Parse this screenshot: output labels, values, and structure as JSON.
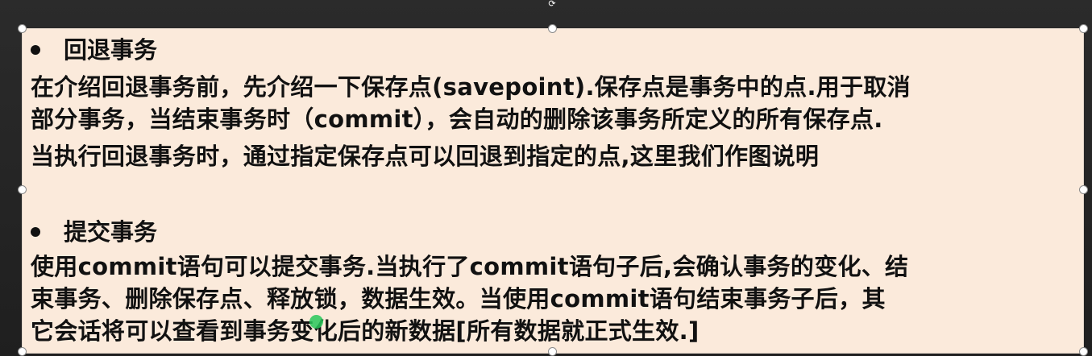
{
  "section1": {
    "heading": "回退事务",
    "lines": [
      "在介绍回退事务前，先介绍一下保存点(savepoint).保存点是事务中的点.用于取消",
      "部分事务，当结束事务时（commit），会自动的删除该事务所定义的所有保存点.",
      "当执行回退事务时，通过指定保存点可以回退到指定的点,这里我们作图说明"
    ]
  },
  "section2": {
    "heading": "提交事务",
    "lines": [
      "使用commit语句可以提交事务.当执行了commit语句子后,会确认事务的变化、结",
      "束事务、删除保存点、释放锁，数据生效。当使用commit语句结束事务子后，其",
      "它会话将可以查看到事务变化后的新数据[所有数据就正式生效.]"
    ]
  },
  "colors": {
    "background": "#1d1d1d",
    "textbox": "#fbeadb",
    "text": "#111111",
    "cursor": "#28c85a"
  },
  "icons": {
    "rotate": "rotate-handle-icon",
    "bullet": "bullet-dot-icon",
    "cursor": "laser-pointer-icon"
  }
}
